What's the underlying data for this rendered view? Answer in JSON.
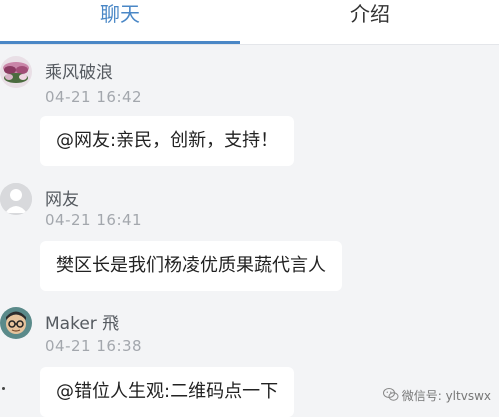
{
  "tabs": {
    "chat": "聊天",
    "intro": "介绍",
    "active_color": "#4a87c6"
  },
  "messages": [
    {
      "name": "乘风破浪",
      "time": "04-21  16:42",
      "text": "@网友:亲民，创新，支持！",
      "avatar": "flower-photo-avatar"
    },
    {
      "name": "网友",
      "time": "04-21  16:41",
      "text": "樊区长是我们杨凌优质果蔬代言人",
      "avatar": "default-person-avatar"
    },
    {
      "name": "Maker 飛",
      "time": "04-21  16:38",
      "text": "@错位人生观:二维码点一下",
      "avatar": "cartoon-glasses-avatar"
    }
  ],
  "watermark": {
    "text": "微信号: yltvswx",
    "icon": "wechat-icon"
  }
}
